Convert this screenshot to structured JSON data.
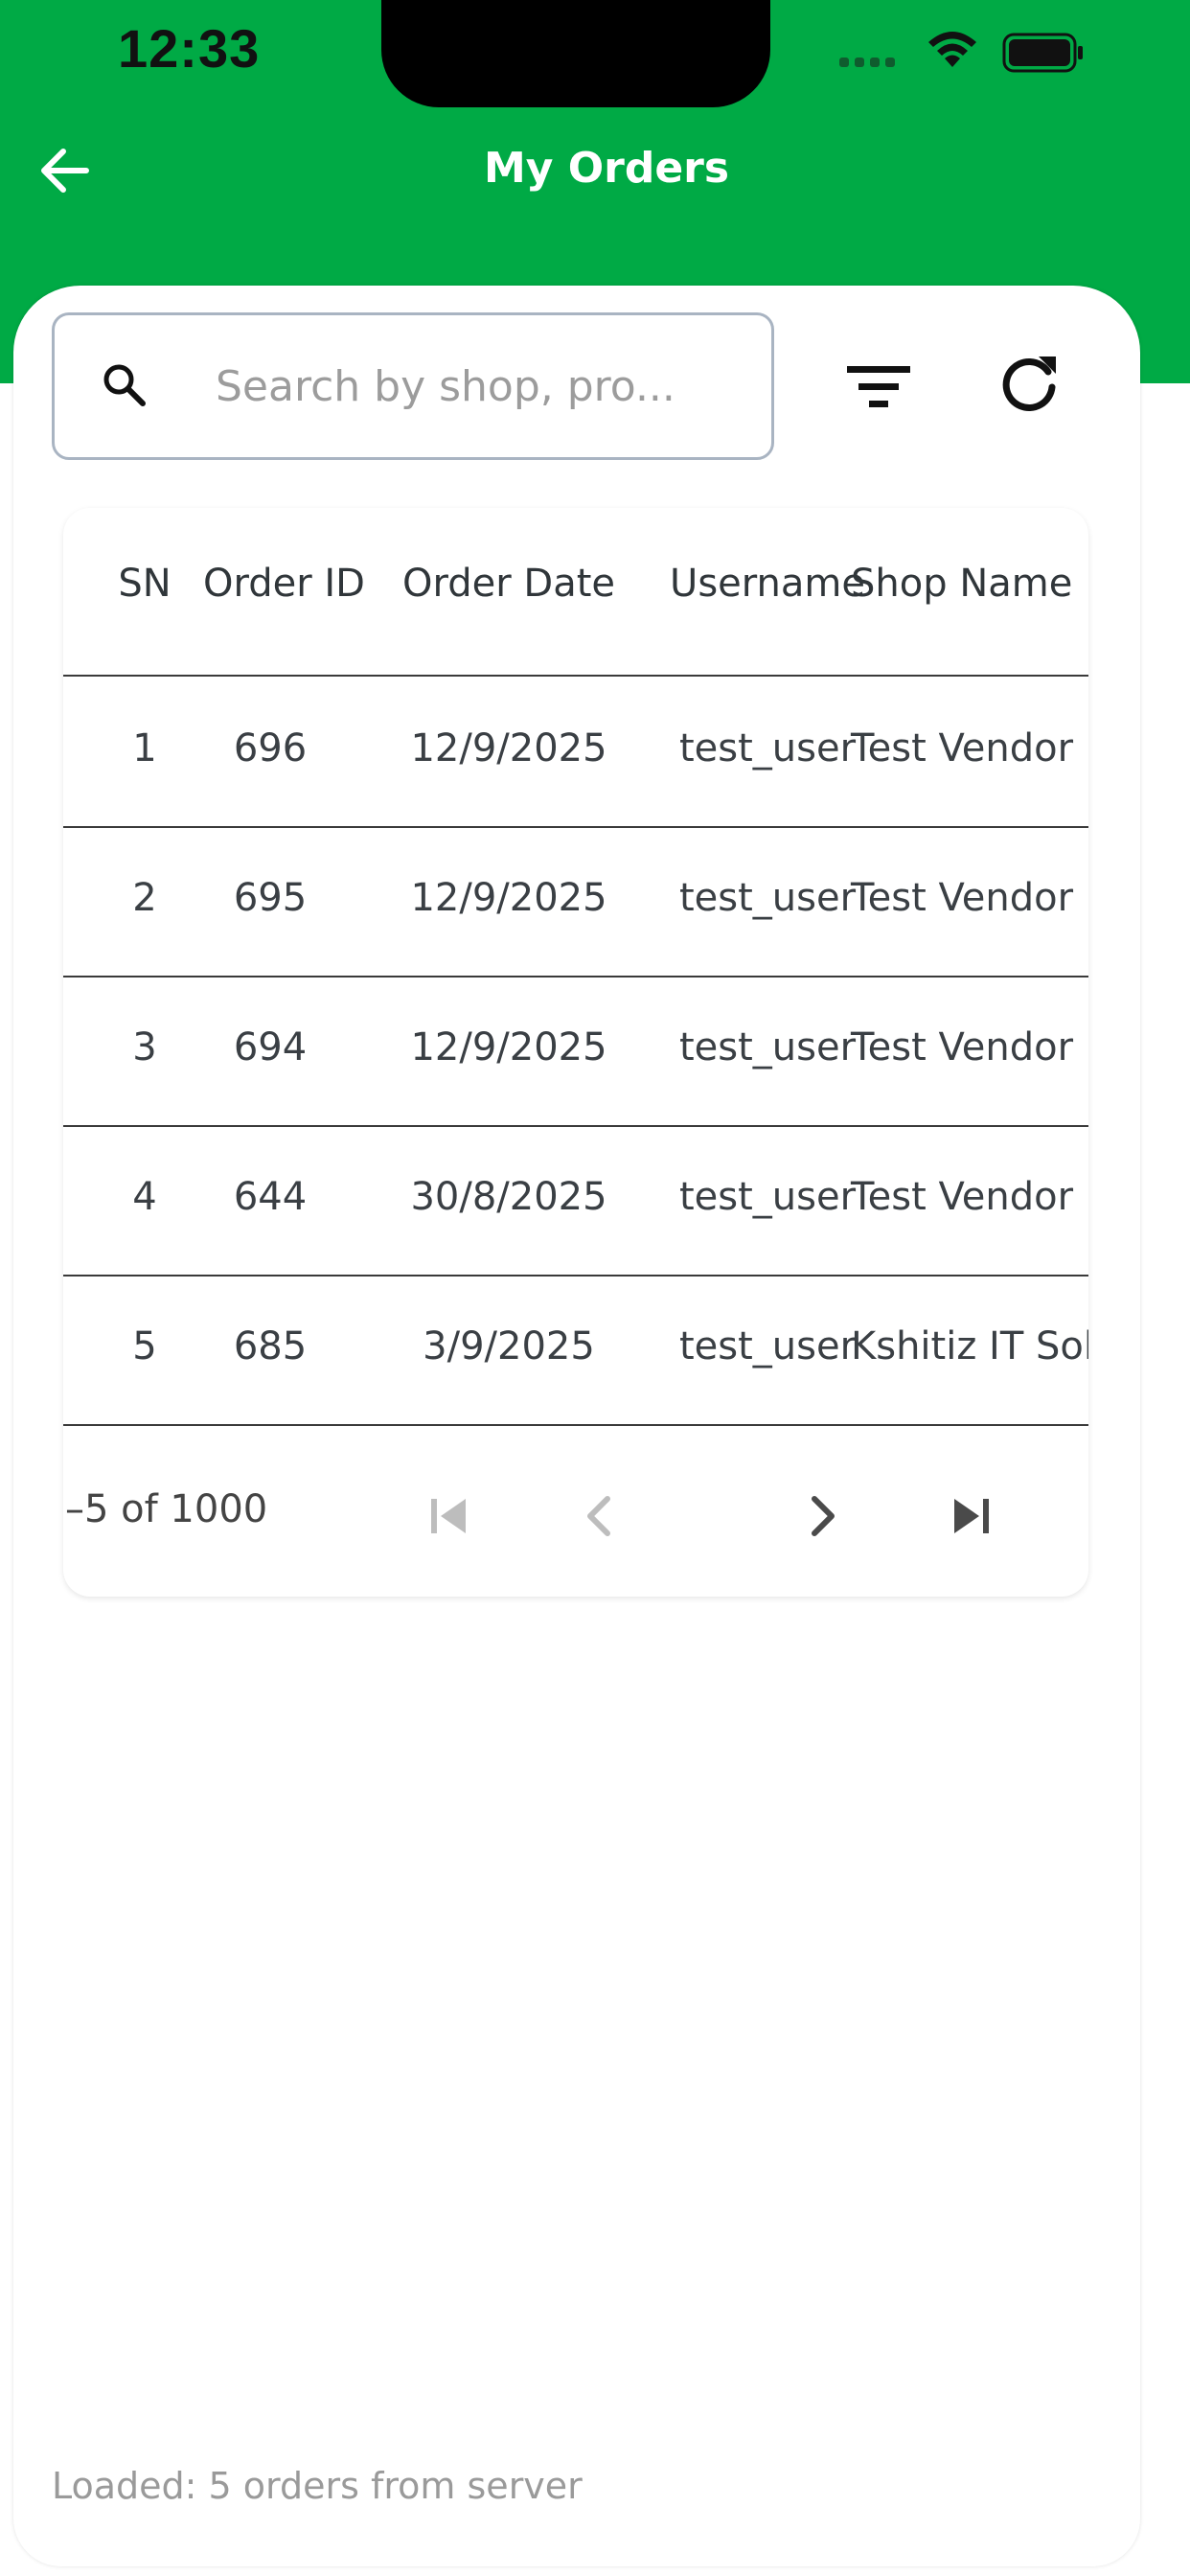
{
  "status_bar": {
    "time": "12:33"
  },
  "header": {
    "title": "My Orders"
  },
  "search": {
    "placeholder": "Search by shop, pro..."
  },
  "table": {
    "columns": [
      "SN",
      "Order ID",
      "Order Date",
      "Username",
      "Shop Name"
    ],
    "rows": [
      [
        "1",
        "696",
        "12/9/2025",
        "test_user",
        "Test Vendor"
      ],
      [
        "2",
        "695",
        "12/9/2025",
        "test_user",
        "Test Vendor"
      ],
      [
        "3",
        "694",
        "12/9/2025",
        "test_user",
        "Test Vendor"
      ],
      [
        "4",
        "644",
        "30/8/2025",
        "test_user",
        "Test Vendor"
      ],
      [
        "5",
        "685",
        "3/9/2025",
        "test_user",
        "Kshitiz IT Sol"
      ]
    ]
  },
  "pagination": {
    "range_text": "–5 of 1000"
  },
  "footer": {
    "status": "Loaded: 5 orders from server"
  },
  "colors": {
    "header_green": "#00aa45",
    "white": "#ffffff"
  }
}
